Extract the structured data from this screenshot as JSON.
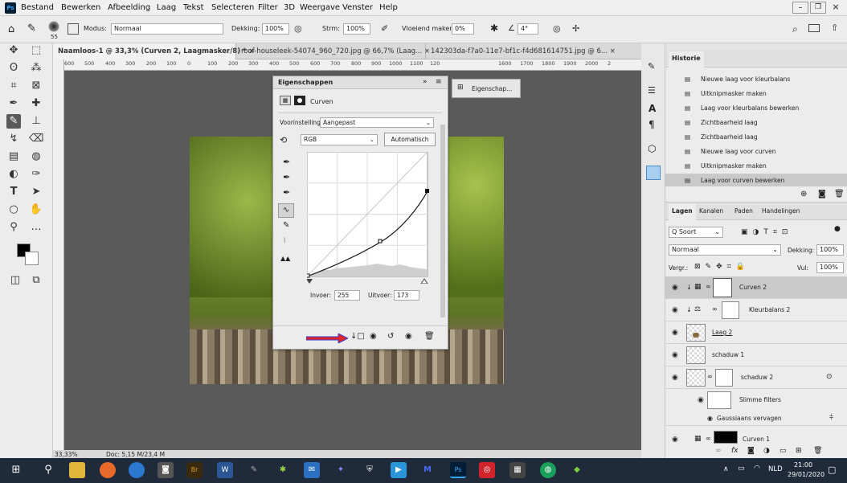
{
  "app_icon": "Ps",
  "menu": [
    "Bestand",
    "Bewerken",
    "Afbeelding",
    "Laag",
    "Tekst",
    "Selecteren",
    "Filter",
    "3D",
    "Weergave",
    "Venster",
    "Help"
  ],
  "options": {
    "brush_size": "55",
    "modus_label": "Modus:",
    "modus_value": "Normaal",
    "dekking_label": "Dekking:",
    "dekking_value": "100%",
    "stroom_label": "Strm:",
    "stroom_value": "100%",
    "vloeiend_label": "Vloeiend maken:",
    "vloeiend_value": "0%",
    "angle_value": "4°"
  },
  "tabs": [
    "Naamloos-1 @ 33,3% (Curven 2, Laagmasker/8) *",
    "roof-houseleek-54074_960_720.jpg @ 66,7% (Laag...",
    "142303da-f7a0-11e7-bf1c-f4d681614751.jpg @ 6..."
  ],
  "ruler_h": [
    "600",
    "500",
    "400",
    "300",
    "200",
    "100",
    "0",
    "100",
    "200",
    "300",
    "400",
    "500",
    "600",
    "700",
    "800",
    "900",
    "1000",
    "1100",
    "120",
    "1600",
    "1700",
    "1800",
    "1900",
    "2000",
    "2"
  ],
  "status": {
    "zoom": "33,33%",
    "doc": "Doc: 5,15 M/23,4 M"
  },
  "properties": {
    "title": "Eigenschappen",
    "subtitle": "Curven",
    "preset_label": "Voorinstelling:",
    "preset_value": "Aangepast",
    "channel": "RGB",
    "auto_button": "Automatisch",
    "invoer_label": "Invoer:",
    "invoer_value": "255",
    "uitvoer_label": "Uitvoer:",
    "uitvoer_value": "173"
  },
  "collapsed_panel_label": "Eigenschap...",
  "history": {
    "title": "Historie",
    "items": [
      "Nieuwe laag voor kleurbalans",
      "Uitknipmasker maken",
      "Laag voor kleurbalans bewerken",
      "Zichtbaarheid laag",
      "Zichtbaarheid laag",
      "Nieuwe laag voor curven",
      "Uitknipmasker maken",
      "Laag voor curven bewerken"
    ]
  },
  "layers": {
    "tabs": [
      "Lagen",
      "Kanalen",
      "Paden",
      "Handelingen"
    ],
    "filter_label": "Q Soort",
    "blend": "Normaal",
    "opacity_label": "Dekking:",
    "opacity_value": "100%",
    "lock_label": "Vergr.:",
    "fill_label": "Vul:",
    "fill_value": "100%",
    "rows": [
      {
        "name": "Curven 2"
      },
      {
        "name": "Kleurbalans 2"
      },
      {
        "name": "Laag 2"
      },
      {
        "name": "schaduw 1"
      },
      {
        "name": "schaduw 2"
      },
      {
        "name": "Slimme filters"
      },
      {
        "name": "Gaussiaans vervagen"
      },
      {
        "name": "Curven 1"
      }
    ]
  },
  "tray": {
    "lang": "NLD",
    "time": "21:00",
    "date": "29/01/2020"
  },
  "colors": {
    "accent": "#1473e6",
    "arrow": "#e0242b",
    "taskbar": "#1f2a3a"
  }
}
